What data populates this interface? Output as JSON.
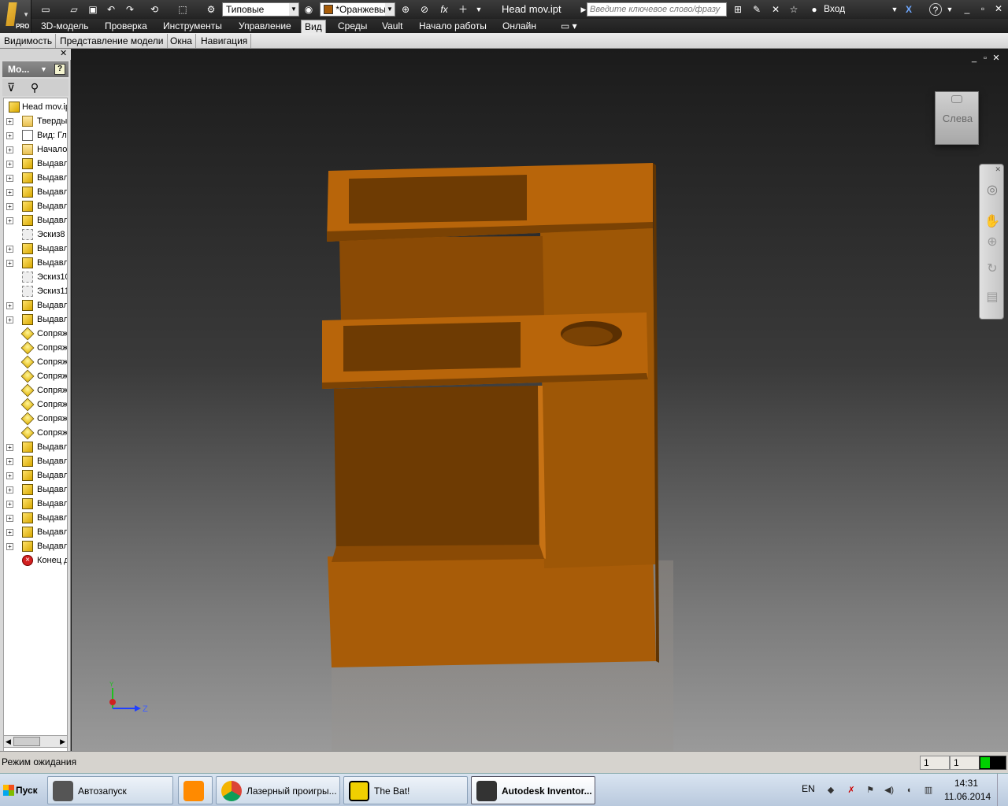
{
  "titlebar": {
    "style_combo": "Типовые",
    "color_combo": "*Оранжевы",
    "document_title": "Head mov.ipt",
    "search_placeholder": "Введите ключевое слово/фразу",
    "login": "Вход",
    "app_badge": "PRO",
    "fx_label": "fx"
  },
  "ribbon": {
    "tabs": [
      "3D-модель",
      "Проверка",
      "Инструменты",
      "Управление",
      "Вид",
      "Среды",
      "Vault",
      "Начало работы",
      "Онлайн"
    ],
    "active_tab": "Вид",
    "panels": [
      "Видимость",
      "Представление модели",
      "Окна",
      "Навигация"
    ]
  },
  "browser": {
    "title": "Мо...",
    "help": "?",
    "root": "Head mov.ipt",
    "items": [
      {
        "label": "Тверды",
        "icon": "folder-icon",
        "expander": true
      },
      {
        "label": "Вид: Гл",
        "icon": "view-icon",
        "expander": true
      },
      {
        "label": "Начало",
        "icon": "folder-icon",
        "expander": true
      },
      {
        "label": "Выдавл",
        "icon": "extrude-icon",
        "expander": true
      },
      {
        "label": "Выдавл",
        "icon": "extrude-icon",
        "expander": true
      },
      {
        "label": "Выдавл",
        "icon": "extrude-icon",
        "expander": true
      },
      {
        "label": "Выдавл",
        "icon": "extrude-icon",
        "expander": true
      },
      {
        "label": "Выдавл",
        "icon": "extrude-icon",
        "expander": true
      },
      {
        "label": "Эскиз8",
        "icon": "sketch-icon",
        "expander": false
      },
      {
        "label": "Выдавл",
        "icon": "extrude-icon",
        "expander": true
      },
      {
        "label": "Выдавл",
        "icon": "extrude-icon",
        "expander": true
      },
      {
        "label": "Эскиз10",
        "icon": "sketch-icon",
        "expander": false
      },
      {
        "label": "Эскиз11",
        "icon": "sketch-icon",
        "expander": false
      },
      {
        "label": "Выдавл",
        "icon": "extrude-icon",
        "expander": true
      },
      {
        "label": "Выдавл",
        "icon": "extrude-icon",
        "expander": true
      },
      {
        "label": "Сопряж",
        "icon": "fillet-icon",
        "expander": false
      },
      {
        "label": "Сопряж",
        "icon": "fillet-icon",
        "expander": false
      },
      {
        "label": "Сопряж",
        "icon": "fillet-icon",
        "expander": false
      },
      {
        "label": "Сопряж",
        "icon": "fillet-icon",
        "expander": false
      },
      {
        "label": "Сопряж",
        "icon": "fillet-icon",
        "expander": false
      },
      {
        "label": "Сопряж",
        "icon": "fillet-icon",
        "expander": false
      },
      {
        "label": "Сопряж",
        "icon": "fillet-icon",
        "expander": false
      },
      {
        "label": "Сопряж",
        "icon": "fillet-icon",
        "expander": false
      },
      {
        "label": "Выдавл",
        "icon": "extrude-icon",
        "expander": true
      },
      {
        "label": "Выдавл",
        "icon": "extrude-icon",
        "expander": true
      },
      {
        "label": "Выдавл",
        "icon": "extrude-icon",
        "expander": true
      },
      {
        "label": "Выдавл",
        "icon": "extrude-icon",
        "expander": true
      },
      {
        "label": "Выдавл",
        "icon": "extrude-icon",
        "expander": true
      },
      {
        "label": "Выдавл",
        "icon": "extrude-icon",
        "expander": true
      },
      {
        "label": "Выдавл",
        "icon": "extrude-icon",
        "expander": true
      },
      {
        "label": "Выдавл",
        "icon": "extrude-icon",
        "expander": true
      },
      {
        "label": "Конец д",
        "icon": "end-of-part-icon",
        "expander": false
      }
    ]
  },
  "viewport": {
    "viewcube_face": "Слева",
    "triad_y": "Y",
    "triad_z": "Z",
    "part_color": "#a85c08"
  },
  "status": {
    "text": "Режим ожидания",
    "field1": "1",
    "field2": "1"
  },
  "taskbar": {
    "start": "Пуск",
    "items": [
      {
        "label": "Автозапуск"
      },
      {
        "label": ""
      },
      {
        "label": "Лазерный проигры..."
      },
      {
        "label": "The Bat!"
      },
      {
        "label": "Autodesk Inventor..."
      }
    ],
    "language": "EN",
    "time": "14:31",
    "date": "11.06.2014"
  }
}
